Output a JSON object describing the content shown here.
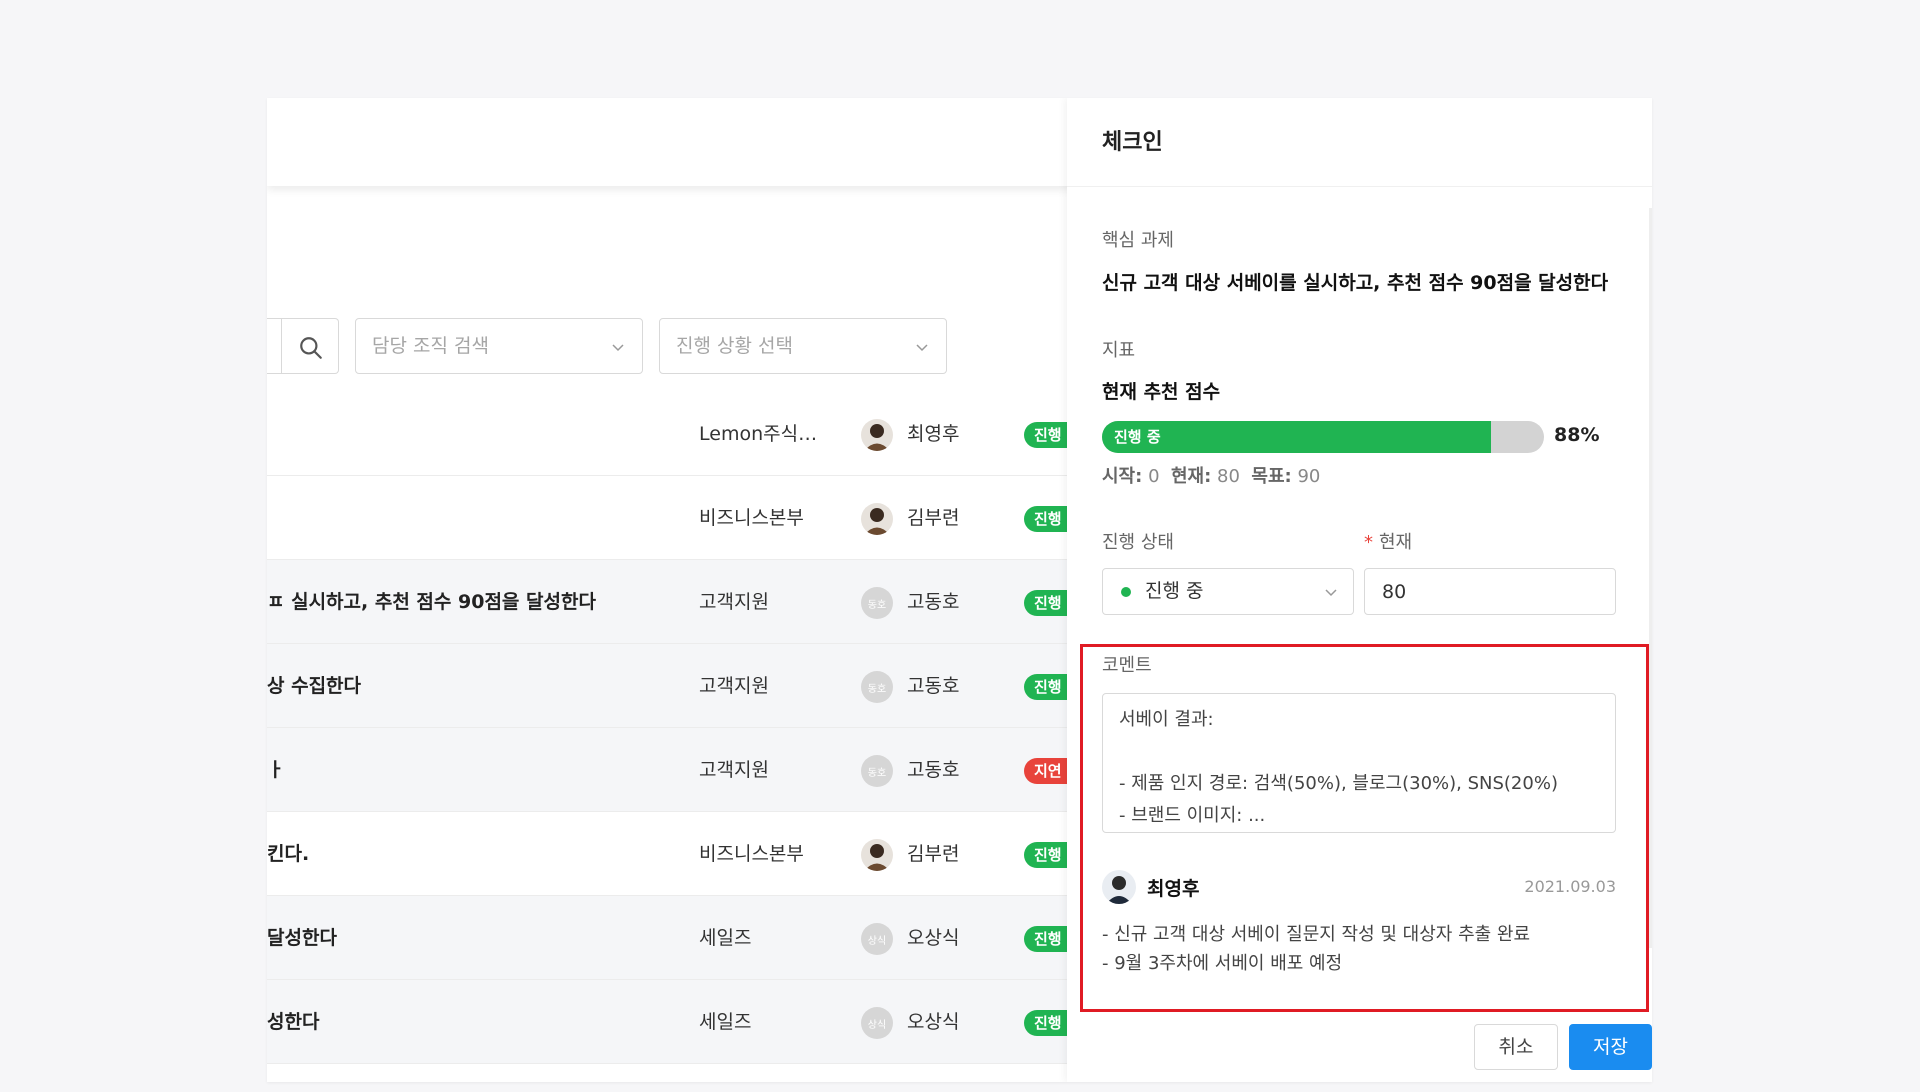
{
  "filters": {
    "org_placeholder": "담당 조직 검색",
    "status_placeholder": "진행 상황 선택"
  },
  "rows": [
    {
      "name": "",
      "org": "Lemon주식…",
      "owner": "최영후",
      "avatar": "photo",
      "badge": "진행",
      "badge_color": "#20b452"
    },
    {
      "name": "",
      "org": "비즈니스본부",
      "owner": "김부련",
      "avatar": "photo",
      "badge": "진행",
      "badge_color": "#20b452"
    },
    {
      "name": "ㅍ 실시하고, 추천 점수 90점을 달성한다",
      "org": "고객지원",
      "owner": "고동호",
      "avatar": "동호",
      "badge": "진행",
      "badge_color": "#20b452"
    },
    {
      "name": "상 수집한다",
      "org": "고객지원",
      "owner": "고동호",
      "avatar": "동호",
      "badge": "진행",
      "badge_color": "#20b452"
    },
    {
      "name": "ㅏ",
      "org": "고객지원",
      "owner": "고동호",
      "avatar": "동호",
      "badge": "지연",
      "badge_color": "#e8433b"
    },
    {
      "name": "킨다.",
      "org": "비즈니스본부",
      "owner": "김부련",
      "avatar": "photo",
      "badge": "진행",
      "badge_color": "#20b452"
    },
    {
      "name": "달성한다",
      "org": "세일즈",
      "owner": "오상식",
      "avatar": "상식",
      "badge": "진행",
      "badge_color": "#20b452"
    },
    {
      "name": "성한다",
      "org": "세일즈",
      "owner": "오상식",
      "avatar": "상식",
      "badge": "진행",
      "badge_color": "#20b452"
    }
  ],
  "panel": {
    "title": "체크인",
    "key_task_label": "핵심 과제",
    "key_task": "신규 고객 대상 서베이를 실시하고, 추천 점수 90점을 달성한다",
    "metric_label": "지표",
    "metric": "현재 추천 점수",
    "progress_label": "진행 중",
    "progress_fraction": 0.88,
    "progress_text": "88%",
    "meta": {
      "start_label": "시작:",
      "start_value": "0",
      "current_label": "현재:",
      "current_value": "80",
      "target_label": "목표:",
      "target_value": "90"
    },
    "status_label": "진행 상태",
    "status_value": "진행 중",
    "current_label": "현재",
    "current_input": "80",
    "comment_label": "코멘트",
    "comment_text": "서베이 결과:\n\n- 제품 인지 경로: 검색(50%), 블로그(30%), SNS(20%)\n- 브랜드 이미지: ...",
    "comment_author": "최영후",
    "comment_date": "2021.09.03",
    "comment_lines": [
      "- 신규 고객 대상 서베이 질문지 작성 및 대상자 추출 완료",
      "- 9월 3주차에 서베이 배포 예정"
    ],
    "cancel_label": "취소",
    "save_label": "저장"
  },
  "colors": {
    "accent": "#1a8cf0",
    "success": "#20b452",
    "danger": "#e8433b",
    "highlight": "#e01b24"
  }
}
